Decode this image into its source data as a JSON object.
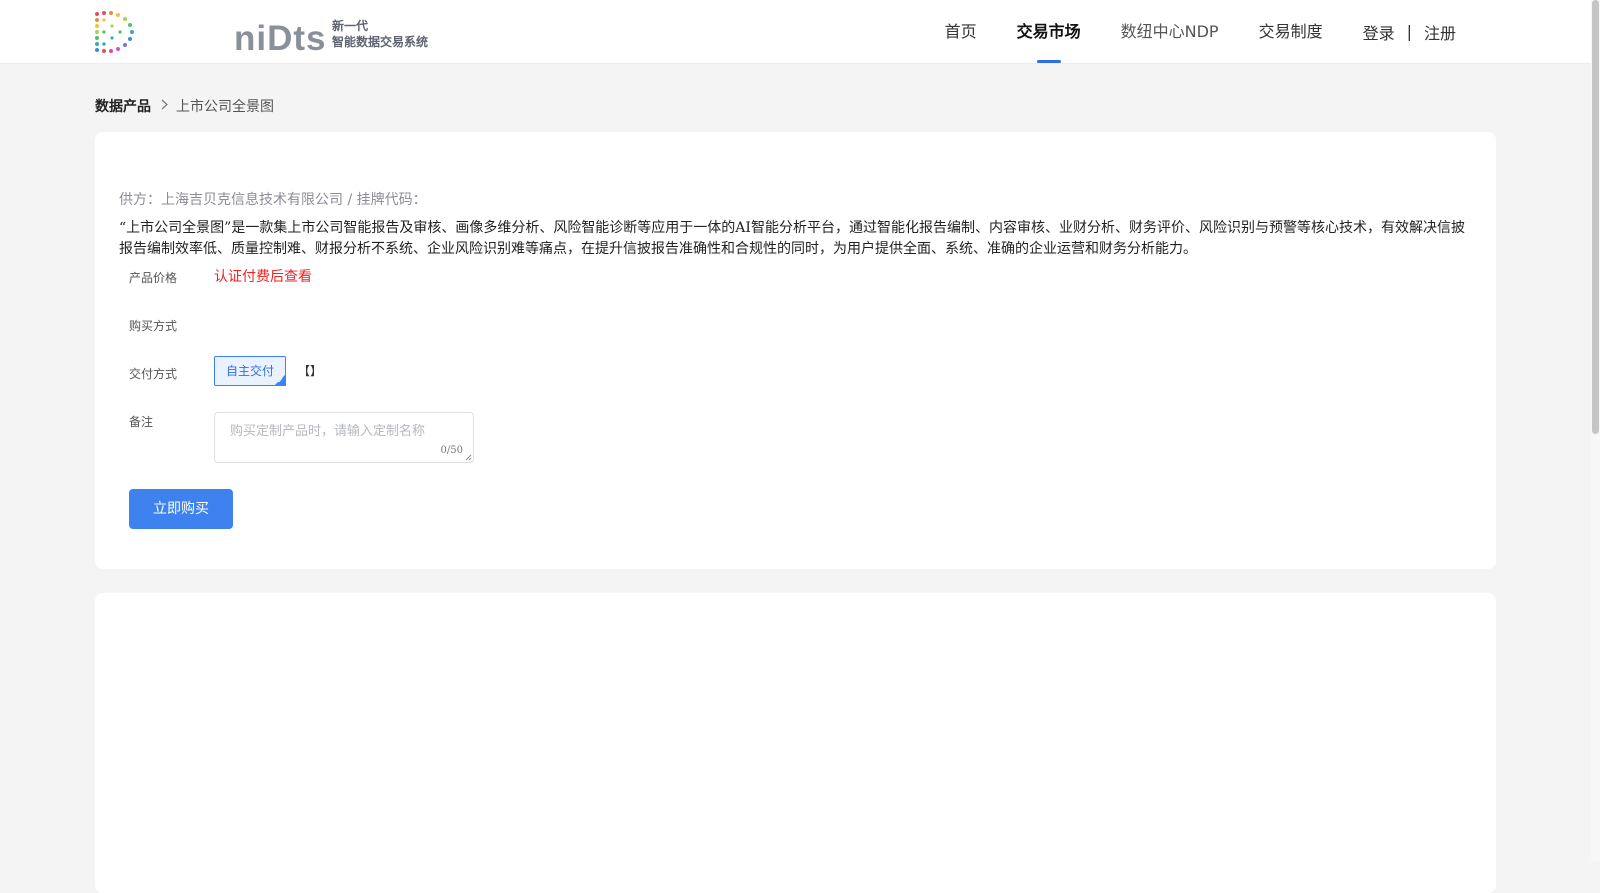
{
  "header": {
    "logo_text": "niDts",
    "logo_sub_line1": "新一代",
    "logo_sub_line2": "智能数据交易系统",
    "nav": [
      {
        "label": "首页"
      },
      {
        "label": "交易市场"
      },
      {
        "label": "数纽中心NDP"
      },
      {
        "label": "交易制度"
      }
    ],
    "active_nav": "交易市场",
    "login_label": "登录",
    "auth_separator": "|",
    "register_label": "注册"
  },
  "breadcrumb": {
    "root": "数据产品",
    "separator": ">",
    "current": "上市公司全景图"
  },
  "product": {
    "supplier_line": "供方：上海吉贝克信息技术有限公司 / 挂牌代码：",
    "description": "“上市公司全景图”是一款集上市公司智能报告及审核、画像多维分析、风险智能诊断等应用于一体的AI智能分析平台，通过智能化报告编制、内容审核、业财分析、财务评价、风险识别与预警等核心技术，有效解决信披报告编制效率低、质量控制难、财报分析不系统、企业风险识别难等痛点，在提升信披报告准确性和合规性的同时，为用户提供全面、系统、准确的企业运营和财务分析能力。",
    "price_label": "产品价格",
    "price_value": "认证付费后查看",
    "purchase_label": "购买方式",
    "delivery_label": "交付方式",
    "delivery_option": "自主交付",
    "delivery_bracket": "【】",
    "remark_label": "备注",
    "remark_placeholder": "购买定制产品时，请输入定制名称",
    "remark_count": "0/50",
    "buy_button": "立即购买"
  },
  "colors": {
    "accent": "#3d82ee",
    "price_red": "#f02323",
    "background": "#f4f4f4"
  }
}
